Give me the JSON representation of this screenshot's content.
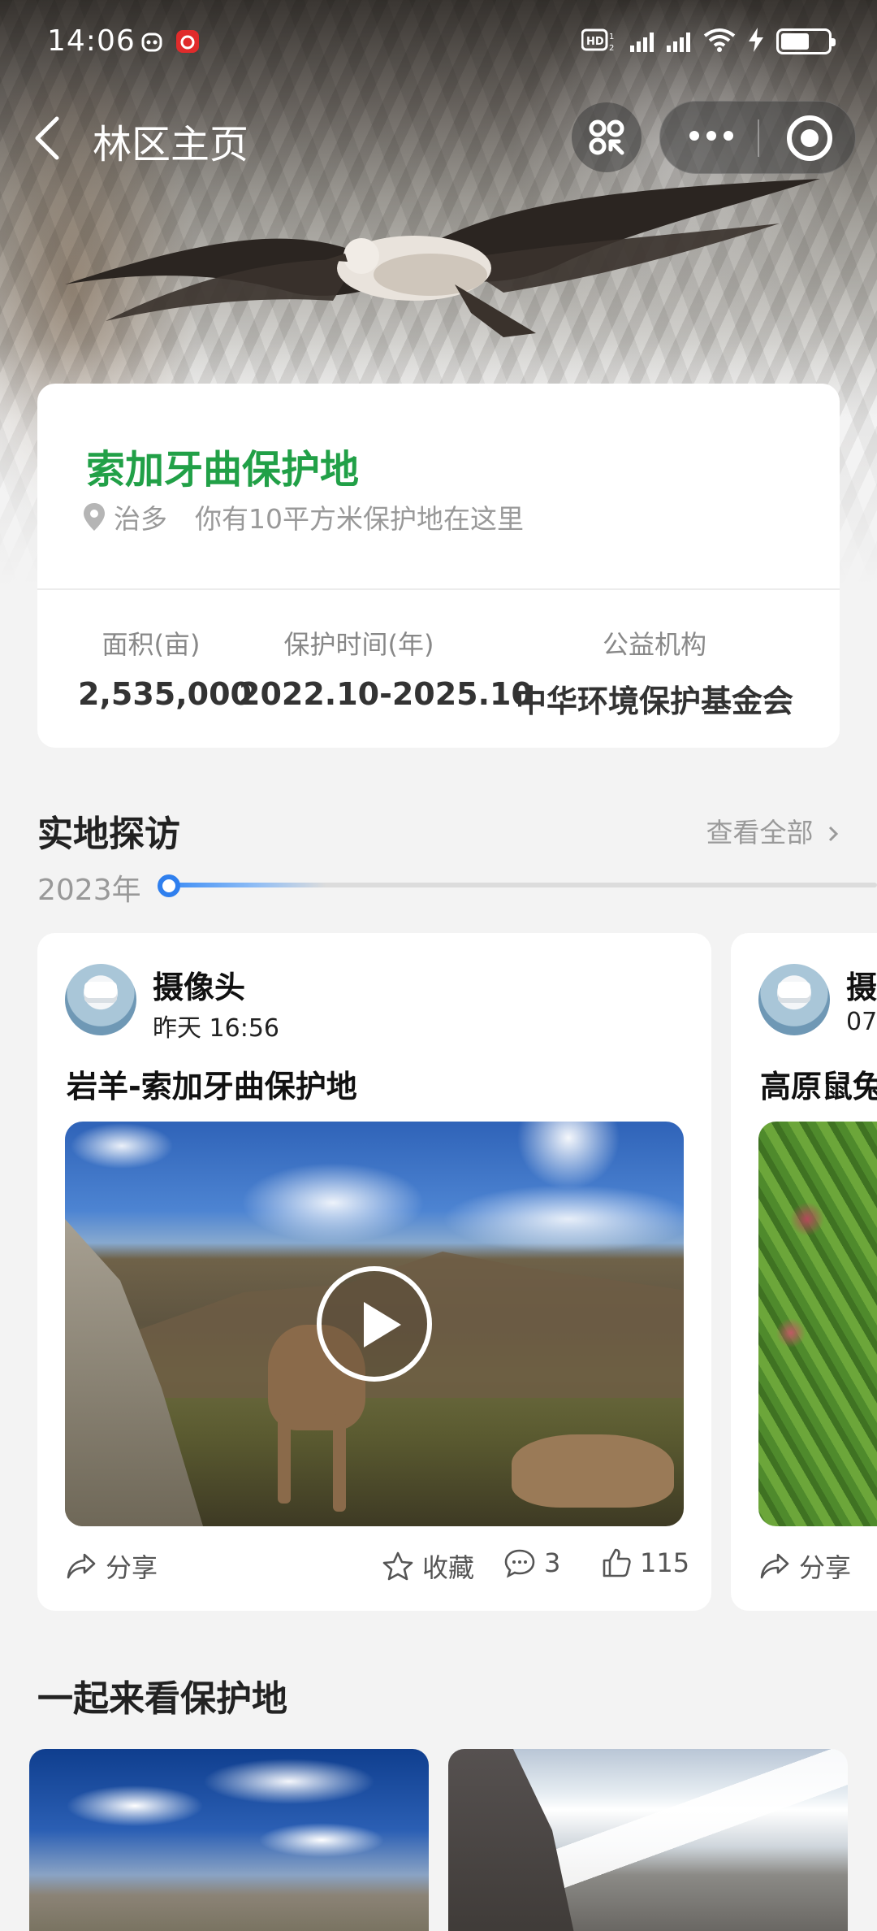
{
  "status": {
    "time": "14:06"
  },
  "nav": {
    "title": "林区主页"
  },
  "reserve": {
    "name": "索加牙曲保护地",
    "location": "治多",
    "tagline": "你有10平方米保护地在这里",
    "stats": [
      {
        "label": "面积(亩)",
        "value": "2,535,000"
      },
      {
        "label": "保护时间(年)",
        "value": "2022.10-2025.10"
      },
      {
        "label": "公益机构",
        "value": "中华环境保护基金会"
      }
    ]
  },
  "visits": {
    "title": "实地探访",
    "view_all": "查看全部",
    "year": "2023年",
    "posts": [
      {
        "author": "摄像头",
        "time": "昨天 16:56",
        "title": "岩羊-索加牙曲保护地",
        "share": "分享",
        "favorite": "收藏",
        "comments": "3",
        "likes": "115"
      },
      {
        "author": "摄",
        "time": "07",
        "title": "高原鼠兔",
        "share": "分享"
      }
    ]
  },
  "explore": {
    "title": "一起来看保护地"
  }
}
